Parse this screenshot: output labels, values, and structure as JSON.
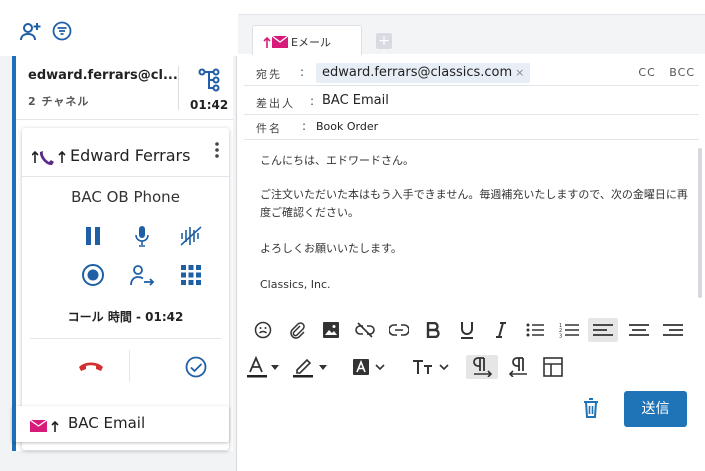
{
  "left": {
    "interaction": {
      "email": "edward.ferrars@cl...",
      "channels": "2 チャネル",
      "timer": "01:42"
    },
    "call": {
      "name": "Edward Ferrars",
      "queue": "BAC OB Phone",
      "duration": "コール 時間 - 01:42"
    },
    "email_item": {
      "label": "BAC Email"
    }
  },
  "right": {
    "tab": {
      "label": "Eメール"
    },
    "to": {
      "label": "宛先",
      "recipient": "edward.ferrars@classics.com",
      "remove": "×",
      "cc": "CC",
      "bcc": "BCC"
    },
    "from": {
      "label": "差出人",
      "value": "BAC Email"
    },
    "subject": {
      "label": "件名",
      "value": "Book Order"
    },
    "body": {
      "line1": "こんにちは、エドワードさん。",
      "line2": "ご注文いただいた本はもう入手できません。毎週補充いたしますので、次の金曜日に再度ご確認ください。",
      "line3": "よろしくお願いいたします。",
      "line4": "Classics, Inc."
    },
    "send_label": "送信"
  },
  "colors": {
    "accent": "#1f73b7",
    "hangup": "#d32f2f",
    "email_pink": "#d81b7a",
    "call_purple": "#5b2a86"
  }
}
